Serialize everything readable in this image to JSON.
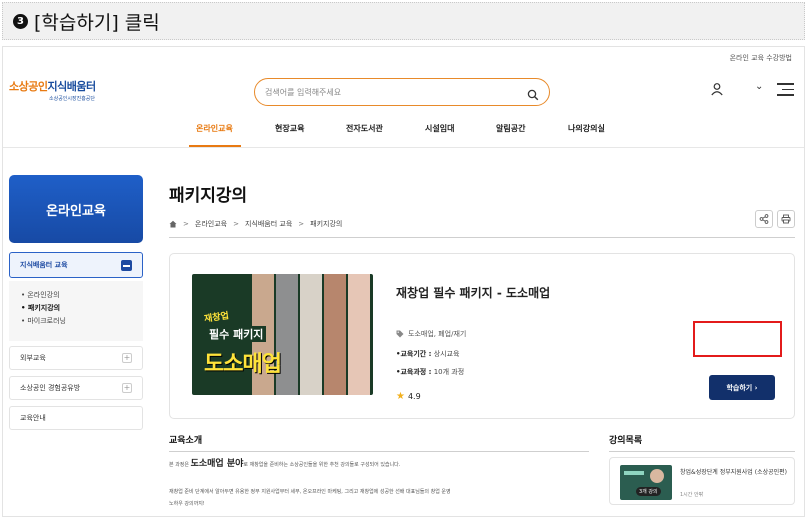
{
  "instruction": {
    "number": "3",
    "text": "[학습하기] 클릭"
  },
  "header": {
    "util_link": "온라인 교육 수강방법",
    "logo_main_1": "소상공인",
    "logo_main_2": "지식배움터",
    "logo_sub": "소상공인시장진흥공단",
    "search_placeholder": "검색어를 입력해주세요"
  },
  "gnb": [
    "온라인교육",
    "현장교육",
    "전자도서관",
    "시설임대",
    "알림공간",
    "나의강의실"
  ],
  "sidebar": {
    "title": "온라인교육",
    "active_label": "지식배움터 교육",
    "sub_items": [
      "• 온라인강의",
      "• 패키지강의",
      "• 마이크로러닝"
    ],
    "items": [
      "외부교육",
      "소상공인 경험공유방",
      "교육안내"
    ]
  },
  "main": {
    "page_title": "패키지강의",
    "breadcrumb": [
      "온라인교육",
      "지식배움터 교육",
      "패키지강의"
    ],
    "breadcrumb_sep": ">",
    "course": {
      "thumb_line1": "재창업",
      "thumb_line2": "필수 패키지",
      "thumb_line3": "도소매업",
      "title": "재창업 필수 패키지 - 도소매업",
      "tags": "도소매업, 폐업/재기",
      "period_label": "•교육기간 :",
      "period_value": " 상시교육",
      "process_label": "•교육과정 :",
      "process_value": " 10개 과정",
      "rating": "4.9",
      "learn_label": "학습하기 ›"
    },
    "intro": {
      "title": "교육소개",
      "line1_pre": "본 과정은 ",
      "line1_big": "도소매업 분야",
      "line1_post": "로 재창업을 준비하는 소상공인들을 위한 추천 강의들로 구성되어 있습니다.",
      "line2": "재창업 준비 단계에서 알아두면 유용한 정부 지원사업부터 세무, 온오프라인 마케팅, 그리고 재창업에 성공한 선배 대표님들의 창업 운영",
      "line3": "노하우 강의까지!"
    },
    "lectures": {
      "title": "강의목록",
      "item_title": "창업&성장단계 정부지원사업 (소상공인편)",
      "item_duration": "1시간 안팎",
      "item_badge": "3개 강의"
    }
  },
  "colors": {
    "accent": "#e87a12",
    "brand_blue": "#1a4d9e",
    "button_navy": "#12306b",
    "highlight_red": "#e31b1b"
  }
}
